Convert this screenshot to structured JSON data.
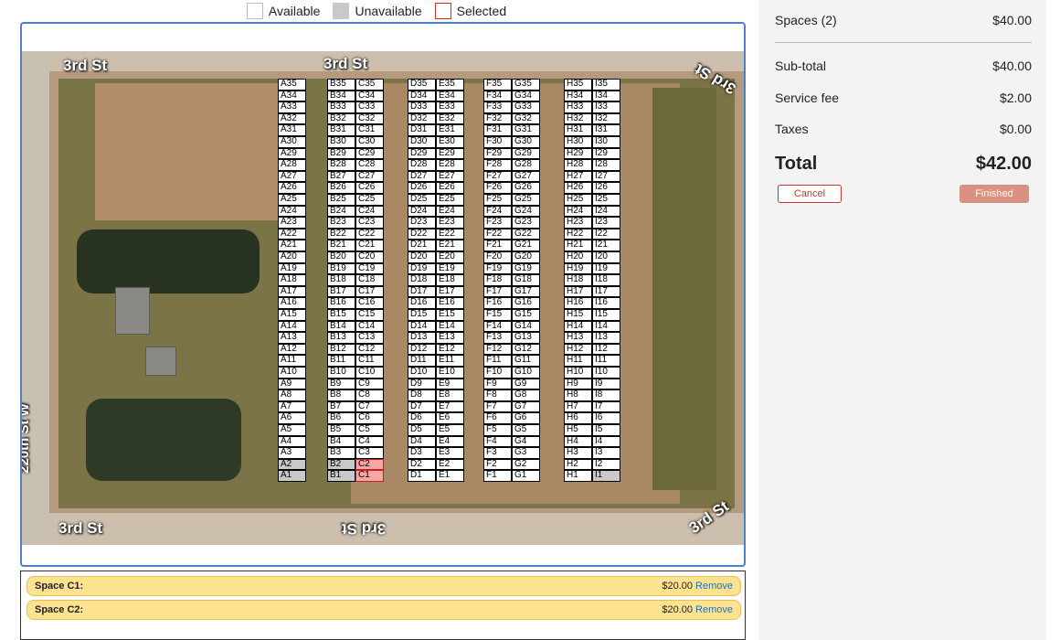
{
  "legend": {
    "available": "Available",
    "unavailable": "Unavailable",
    "selected": "Selected",
    "colors": {
      "available": "#ffffff",
      "unavailable": "#c9c9c9",
      "selected": "#f8a5a5"
    }
  },
  "map": {
    "streets": {
      "top_left": "3rd St",
      "top_center": "3rd St",
      "top_right": "3rd St",
      "bottom_left": "3rd St",
      "bottom_center": "3rd St",
      "bottom_right": "3rd St",
      "left": "220th St W"
    },
    "columns": [
      "A",
      "B",
      "C",
      "D",
      "E",
      "F",
      "G",
      "H",
      "I"
    ],
    "rows_per_column": 35,
    "unavailable": [
      "A2",
      "A1",
      "B2",
      "B1",
      "I1"
    ],
    "selected": [
      "C2",
      "C1"
    ]
  },
  "selections": [
    {
      "label": "Space C1:",
      "price": "$20.00",
      "remove": "Remove"
    },
    {
      "label": "Space C2:",
      "price": "$20.00",
      "remove": "Remove"
    }
  ],
  "summary": {
    "spaces_label": "Spaces (2)",
    "spaces_value": "$40.00",
    "subtotal_label": "Sub-total",
    "subtotal_value": "$40.00",
    "service_fee_label": "Service fee",
    "service_fee_value": "$2.00",
    "taxes_label": "Taxes",
    "taxes_value": "$0.00",
    "total_label": "Total",
    "total_value": "$42.00",
    "cancel_label": "Cancel",
    "finish_label": "Finished",
    "colors": {
      "cancel": "#c0392b",
      "finish": "#d99282"
    }
  }
}
